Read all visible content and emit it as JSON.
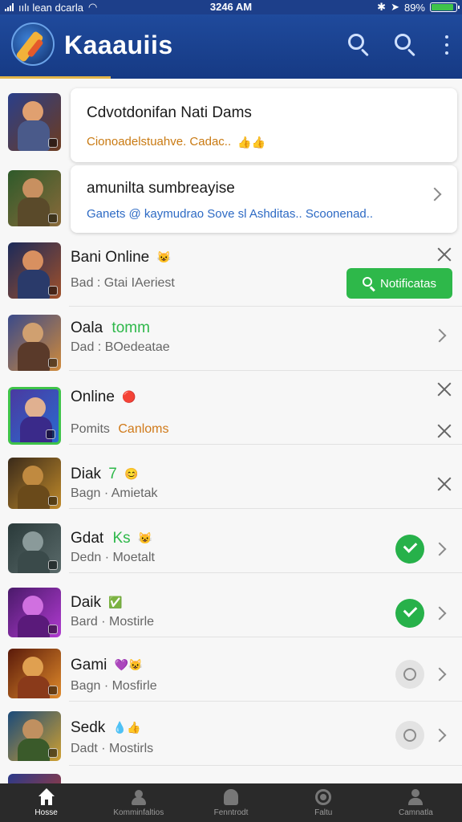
{
  "status_bar": {
    "carrier": "ıılı lean dcarla",
    "time": "3246 AM",
    "battery": "89%",
    "battery_level": 0.89
  },
  "app_bar": {
    "title": "Kaaauiis",
    "icons": [
      "search-icon",
      "search-icon",
      "kebab-menu-icon"
    ]
  },
  "rows": [
    {
      "title": "Cdvotdonifan Nati Dams",
      "subtitle": "Cionoadelstuahve. Cadac..",
      "subtitle_color": "#c97a12",
      "emoji": "👍👍",
      "control": "card"
    },
    {
      "title": "amunilta sumbreayise",
      "subtitle": "Ganets @ kaymudrao Sove sl Ashditas.. Scoonenad..",
      "subtitle_color": "#2d6ac4",
      "control": "card-chevron"
    },
    {
      "title": "Bani Online",
      "emoji": "😺",
      "subtitle": "Bad : Gtai IAeriest",
      "control": "close-notify",
      "button_label": "Notificatas"
    },
    {
      "title": "Oala",
      "title_accent": "tomm",
      "subtitle": "Dad : BOedeatae",
      "control": "chevron"
    },
    {
      "title": "Online",
      "emoji": "🔴",
      "subtitle": "Pomits",
      "subtitle_accent": "Canloms",
      "control": "close-close"
    },
    {
      "title": "Diak",
      "title_accent": "7",
      "emoji": "😊",
      "subtitle": "Bagn · Amietak",
      "control": "close"
    },
    {
      "title": "Gdat",
      "title_accent": "Ks",
      "emoji": "😺",
      "subtitle": "Dedn · Moetalt",
      "control": "check-chevron"
    },
    {
      "title": "Daik",
      "emoji": "✅",
      "subtitle": "Bard · Mostirle",
      "control": "check-chevron"
    },
    {
      "title": "Gami",
      "emoji": "💜😺",
      "subtitle": "Bagn · Mosfirle",
      "control": "circle-chevron"
    },
    {
      "title": "Sedk",
      "emoji": "💧👍",
      "subtitle": "Dadt · Mostirls",
      "control": "circle-chevron"
    }
  ],
  "bottom_nav": [
    {
      "label": "Hosse",
      "icon": "home-icon",
      "active": true
    },
    {
      "label": "Komminfaltios",
      "icon": "group-icon",
      "active": false
    },
    {
      "label": "Fenntrodt",
      "icon": "messages-icon",
      "active": false
    },
    {
      "label": "Faltu",
      "icon": "camera-icon",
      "active": false
    },
    {
      "label": "Camnatla",
      "icon": "profile-icon",
      "active": false
    }
  ],
  "colors": {
    "header": "#1f4a9c",
    "accent_green": "#2eb84a",
    "accent_orange": "#c97a12",
    "accent_blue": "#2d6ac4"
  }
}
